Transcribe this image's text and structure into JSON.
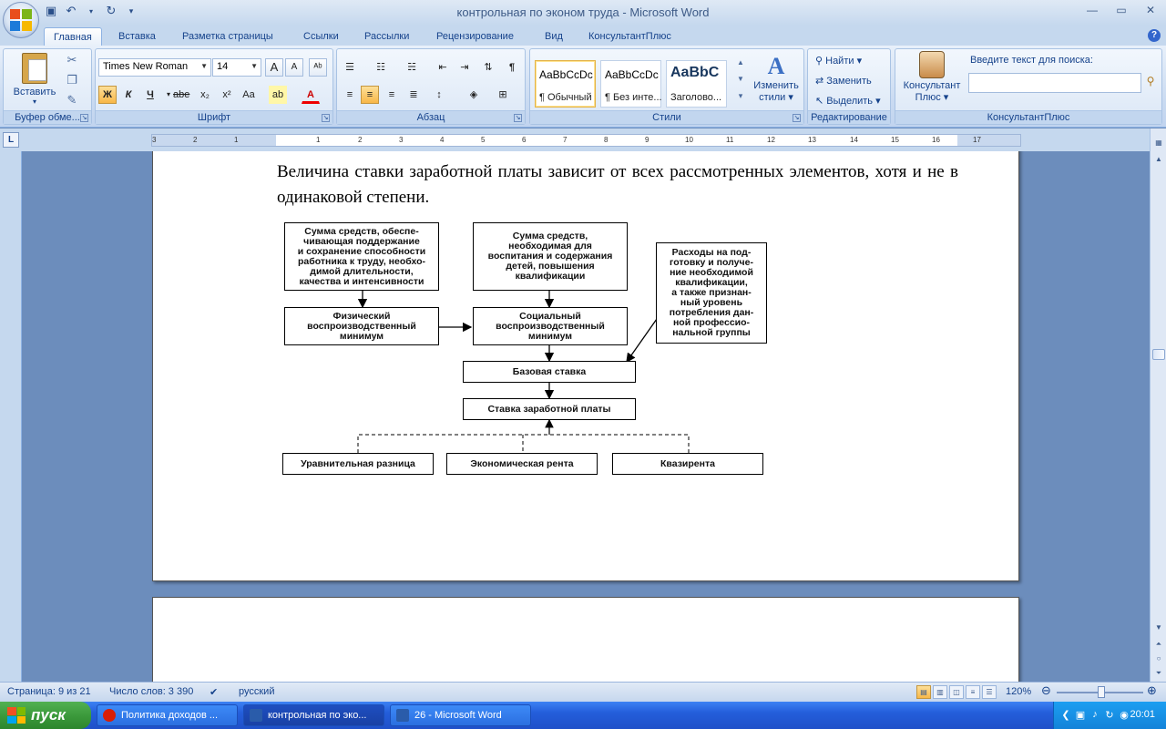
{
  "window": {
    "title": "контрольная по эконом труда - Microsoft Word"
  },
  "tabs": [
    {
      "label": "Главная",
      "active": true
    },
    {
      "label": "Вставка"
    },
    {
      "label": "Разметка страницы"
    },
    {
      "label": "Ссылки"
    },
    {
      "label": "Рассылки"
    },
    {
      "label": "Рецензирование"
    },
    {
      "label": "Вид"
    },
    {
      "label": "КонсультантПлюс"
    }
  ],
  "ribbon": {
    "clipboard": {
      "paste_label": "Вставить",
      "group_label": "Буфер обме..."
    },
    "font": {
      "font_name": "Times New Roman",
      "font_size": "14",
      "bold": "Ж",
      "italic": "К",
      "underline": "Ч",
      "strike": "abe",
      "subscript": "x₂",
      "superscript": "x²",
      "case": "Aa",
      "grow": "A",
      "shrink": "A",
      "group_label": "Шрифт"
    },
    "paragraph": {
      "group_label": "Абзац"
    },
    "styles": {
      "items": [
        {
          "sample": "AaBbCcDc",
          "name": "¶ Обычный"
        },
        {
          "sample": "AaBbCcDc",
          "name": "¶ Без инте..."
        },
        {
          "sample": "AaBbC",
          "name": "Заголово..."
        }
      ],
      "change_label_1": "Изменить",
      "change_label_2": "стили",
      "group_label": "Стили"
    },
    "editing": {
      "find": "Найти",
      "replace": "Заменить",
      "select": "Выделить",
      "group_label": "Редактирование"
    },
    "consultant": {
      "button_label_1": "Консультант",
      "button_label_2": "Плюс",
      "search_label": "Введите текст для поиска:",
      "search_value": "",
      "group_label": "КонсультантПлюс"
    }
  },
  "ruler": {
    "corner": "L",
    "ticks": [
      "3",
      "2",
      "1",
      "1",
      "2",
      "3",
      "4",
      "5",
      "6",
      "7",
      "8",
      "9",
      "10",
      "11",
      "12",
      "13",
      "14",
      "15",
      "16",
      "17"
    ]
  },
  "document": {
    "paragraph": "Величина ставки заработной платы зависит от всех рассмотренных элементов, хотя и не в одинаковой степени.",
    "diagram": {
      "box1": "Сумма средств, обеспе-\nчивающая поддержание\nи сохранение способности\nработника к труду, необхо-\nдимой длительности,\nкачества и интенсивности",
      "box2": "Сумма средств,\nнеобходимая для\nвоспитания и содержания\nдетей, повышения\nквалификации",
      "box3": "Расходы на под-\nготовку и получе-\nние необходимой\nквалификации,\nа также признан-\nный уровень\nпотребления дан-\nной профессио-\nнальной группы",
      "box4": "Физический\nвоспроизводственный\nминимум",
      "box5": "Социальный\nвоспроизводственный\nминимум",
      "box6": "Базовая ставка",
      "box7": "Ставка заработной платы",
      "box8": "Уравнительная разница",
      "box9": "Экономическая рента",
      "box10": "Квазирента"
    }
  },
  "status": {
    "page": "Страница: 9 из 21",
    "words": "Число слов: 3 390",
    "language": "русский",
    "zoom": "120%"
  },
  "taskbar": {
    "start": "пуск",
    "tasks": [
      {
        "label": "Политика доходов ...",
        "color": "#d81e05"
      },
      {
        "label": "контрольная по эко...",
        "color": "#2a5caa",
        "active": true
      },
      {
        "label": "26 - Microsoft Word",
        "color": "#2a5caa"
      }
    ],
    "clock": "20:01"
  }
}
